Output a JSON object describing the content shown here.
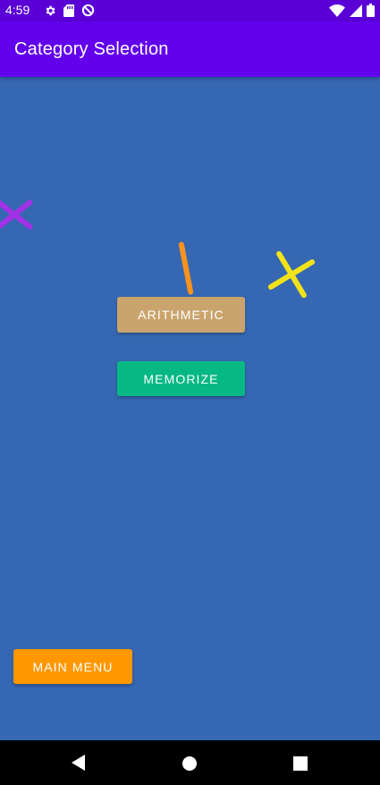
{
  "status_bar": {
    "time": "4:59",
    "left_icons": [
      "gear-icon",
      "sd-card-icon",
      "data-saver-icon"
    ],
    "right_icons": [
      "wifi-icon",
      "signal-icon",
      "battery-icon"
    ]
  },
  "app_bar": {
    "title": "Category Selection",
    "color": "#6200ee"
  },
  "content": {
    "background": "#3567b2",
    "buttons": {
      "arithmetic": "ARITHMETIC",
      "memorize": "MEMORIZE",
      "main_menu": "MAIN MENU"
    },
    "decorations": [
      "purple-x",
      "orange-stick",
      "yellow-x"
    ],
    "colors": {
      "arithmetic": "#c9a46d",
      "memorize": "#06b884",
      "main_menu": "#ff9800",
      "purple": "#a431e8",
      "orange": "#f7931e",
      "yellow": "#f2e21a"
    }
  },
  "nav_bar": {
    "buttons": [
      "back-icon",
      "home-icon",
      "recents-icon"
    ]
  }
}
